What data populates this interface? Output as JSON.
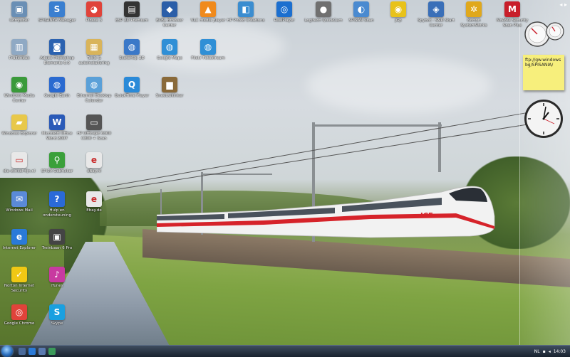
{
  "desktop_icons": [
    {
      "label": "Computer",
      "icon": "computer-icon",
      "color": "#6a8fb5",
      "glyph": "▣"
    },
    {
      "label": "SPISANYA Manager",
      "icon": "spisanya-icon",
      "color": "#3a7fd0",
      "glyph": "S"
    },
    {
      "label": "Picasa 3",
      "icon": "picasa-icon",
      "color": "#e0433a",
      "glyph": "◕"
    },
    {
      "label": "ESP 2D Premium",
      "icon": "train-app-icon",
      "color": "#333333",
      "glyph": "▤"
    },
    {
      "label": "EXBL Browser Center",
      "icon": "browser-center-icon",
      "color": "#2b5ea8",
      "glyph": "◆"
    },
    {
      "label": "VLC media player",
      "icon": "vlc-icon",
      "color": "#f08a1c",
      "glyph": "▲"
    },
    {
      "label": "HP Photo Creations",
      "icon": "hp-photo-icon",
      "color": "#3b8dd0",
      "glyph": "◧"
    },
    {
      "label": "RealPlayer",
      "icon": "realplayer-icon",
      "color": "#1c6fcf",
      "glyph": "◎"
    },
    {
      "label": "Logitech QuickCam",
      "icon": "webcam-icon",
      "color": "#707070",
      "glyph": "●"
    },
    {
      "label": "SPISAN Scan",
      "icon": "scan-icon",
      "color": "#4a8ad0",
      "glyph": "◐"
    },
    {
      "label": "jGp",
      "icon": "jgp-icon",
      "color": "#e8c21a",
      "glyph": "◉"
    },
    {
      "label": "Spybot - S&D Start Center",
      "icon": "spybot-icon",
      "color": "#3a6fb8",
      "glyph": "◈"
    },
    {
      "label": "Norton SystemWorks",
      "icon": "norton-systemworks-icon",
      "color": "#e0a81c",
      "glyph": "✲"
    },
    {
      "label": "McAfee Security Scan Plus",
      "icon": "mcafee-icon",
      "color": "#c81e2a",
      "glyph": "M"
    },
    {
      "label": "Prullenbak",
      "icon": "recycle-bin-icon",
      "color": "#8fa9c4",
      "glyph": "▥"
    },
    {
      "label": "Adobe Photoshop Elements 6.0",
      "icon": "photoshop-elements-icon",
      "color": "#2b62b0",
      "glyph": "◙"
    },
    {
      "label": "Tools & autoinstallering",
      "icon": "tools-icon",
      "color": "#d9b45a",
      "glyph": "▦"
    },
    {
      "label": "SketchUp 2D",
      "icon": "sketchup-icon",
      "color": "#3a78c8",
      "glyph": "◍"
    },
    {
      "label": "Google Maps",
      "icon": "globe-icon",
      "color": "#2f8fd6",
      "glyph": "◍"
    },
    {
      "label": "Flickr Fotostream",
      "icon": "globe-icon-2",
      "color": "#2f8fd6",
      "glyph": "◍"
    },
    {
      "label": "Windows Media Center",
      "icon": "media-center-icon",
      "color": "#3a9a3a",
      "glyph": "◉"
    },
    {
      "label": "Google Earth",
      "icon": "google-earth-icon",
      "color": "#2a6ad0",
      "glyph": "◍"
    },
    {
      "label": "Ethernet Desktop Calendar",
      "icon": "calendar-globe-icon",
      "color": "#5aa0d8",
      "glyph": "◍"
    },
    {
      "label": "QuickTime Player",
      "icon": "quicktime-icon",
      "color": "#2a8ad8",
      "glyph": "Q"
    },
    {
      "label": "Sneeuwkinker",
      "icon": "folder-icon",
      "color": "#8a6a3a",
      "glyph": "▆"
    },
    {
      "label": "Windows Explorer",
      "icon": "windows-explorer-icon",
      "color": "#e8c84a",
      "glyph": "▰"
    },
    {
      "label": "Microsoft Office Word 2007",
      "icon": "word-icon",
      "color": "#2a5ab8",
      "glyph": "W"
    },
    {
      "label": "HP Officejet 6300 C300 + Scan",
      "icon": "printer-icon",
      "color": "#555555",
      "glyph": "▭"
    },
    {
      "label": "die-winkel-fijn.nl",
      "icon": "shortcut-icon",
      "color": "#e8e8e8",
      "glyph": "▭"
    },
    {
      "label": "SPISA Gebruiker",
      "icon": "search-user-icon",
      "color": "#3aa03a",
      "glyph": "⚲"
    },
    {
      "label": "eBay.nl",
      "icon": "ebay-icon",
      "color": "#e8e8e8",
      "glyph": "e"
    },
    {
      "label": "Windows Mail",
      "icon": "windows-mail-icon",
      "color": "#5a8ad8",
      "glyph": "✉"
    },
    {
      "label": "Hulp en ondersteuning",
      "icon": "help-icon",
      "color": "#2a6ad8",
      "glyph": "?"
    },
    {
      "label": "Ebay.de",
      "icon": "ebay-de-icon",
      "color": "#e8e8e8",
      "glyph": "e"
    },
    {
      "label": "Internet Explorer",
      "icon": "internet-explorer-icon",
      "color": "#2a7ad8",
      "glyph": "e"
    },
    {
      "label": "Treinbaan 6 Pro",
      "icon": "train-pro-icon",
      "color": "#444444",
      "glyph": "▣"
    },
    {
      "label": "Norton Internet Security",
      "icon": "norton-icon",
      "color": "#f0c814",
      "glyph": "✓"
    },
    {
      "label": "iTunes",
      "icon": "itunes-icon",
      "color": "#c83aa0",
      "glyph": "♪"
    },
    {
      "label": "Google Chrome",
      "icon": "chrome-icon",
      "color": "#e0433a",
      "glyph": "◎"
    },
    {
      "label": "Skype",
      "icon": "skype-icon",
      "color": "#1aa0e0",
      "glyph": "S"
    }
  ],
  "gadgets": {
    "note_text": "ftp://gw.windowsbg/SPISANIA/",
    "toggle_label": "◂ ▸"
  },
  "taskbar": {
    "language": "NL",
    "time": "14:03",
    "quick_launch": [
      {
        "icon": "show-desktop-icon",
        "color": "#4a6a9a"
      },
      {
        "icon": "ie-quicklaunch-icon",
        "color": "#2a7ad8"
      },
      {
        "icon": "switch-windows-icon",
        "color": "#5a7ab0"
      },
      {
        "icon": "media-player-icon",
        "color": "#3a9a5a"
      }
    ]
  }
}
